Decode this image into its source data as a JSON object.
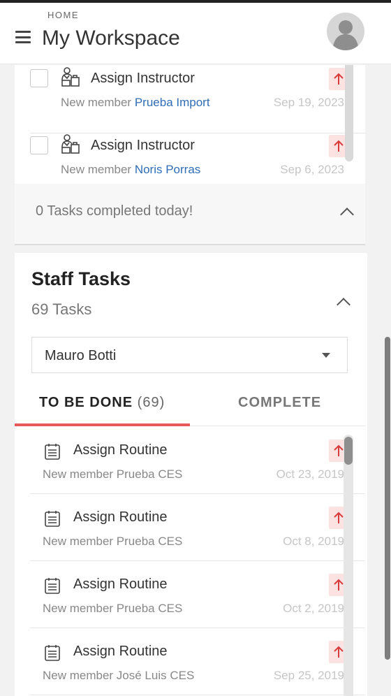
{
  "header": {
    "breadcrumb": "HOME",
    "title": "My Workspace",
    "menu_icon": "hamburger-menu-icon",
    "avatar_icon": "user-avatar-icon"
  },
  "my_tasks": {
    "items": [
      {
        "name": "Assign Instructor",
        "sub_prefix": "New member",
        "sub_link": "Prueba Import",
        "date": "Sep 19, 2023",
        "icon": "assign-instructor-icon",
        "priority_icon": "priority-high-icon"
      },
      {
        "name": "Assign Instructor",
        "sub_prefix": "New member",
        "sub_link": "Noris Porras",
        "date": "Sep 6, 2023",
        "icon": "assign-instructor-icon",
        "priority_icon": "priority-high-icon"
      }
    ],
    "completed_today": "0 Tasks completed today!"
  },
  "staff_tasks": {
    "title": "Staff Tasks",
    "count_label": "69 Tasks",
    "staff_select": "Mauro Botti",
    "tabs": {
      "to_be_done_label": "TO BE DONE",
      "to_be_done_count": "(69)",
      "complete_label": "COMPLETE"
    },
    "items": [
      {
        "name": "Assign Routine",
        "sub": "New member Prueba CES",
        "date": "Oct 23, 2019",
        "icon": "calendar-icon"
      },
      {
        "name": "Assign Routine",
        "sub": "New member Prueba CES",
        "date": "Oct 8, 2019",
        "icon": "calendar-icon"
      },
      {
        "name": "Assign Routine",
        "sub": "New member Prueba CES",
        "date": "Oct 2, 2019",
        "icon": "calendar-icon"
      },
      {
        "name": "Assign Routine",
        "sub": "New member José Luis CES",
        "date": "Sep 25, 2019",
        "icon": "calendar-icon"
      }
    ]
  },
  "colors": {
    "accent": "#e85a5a",
    "link": "#2f6db5",
    "priority_bg": "#fde2e2",
    "priority_arrow": "#d93a3a"
  }
}
